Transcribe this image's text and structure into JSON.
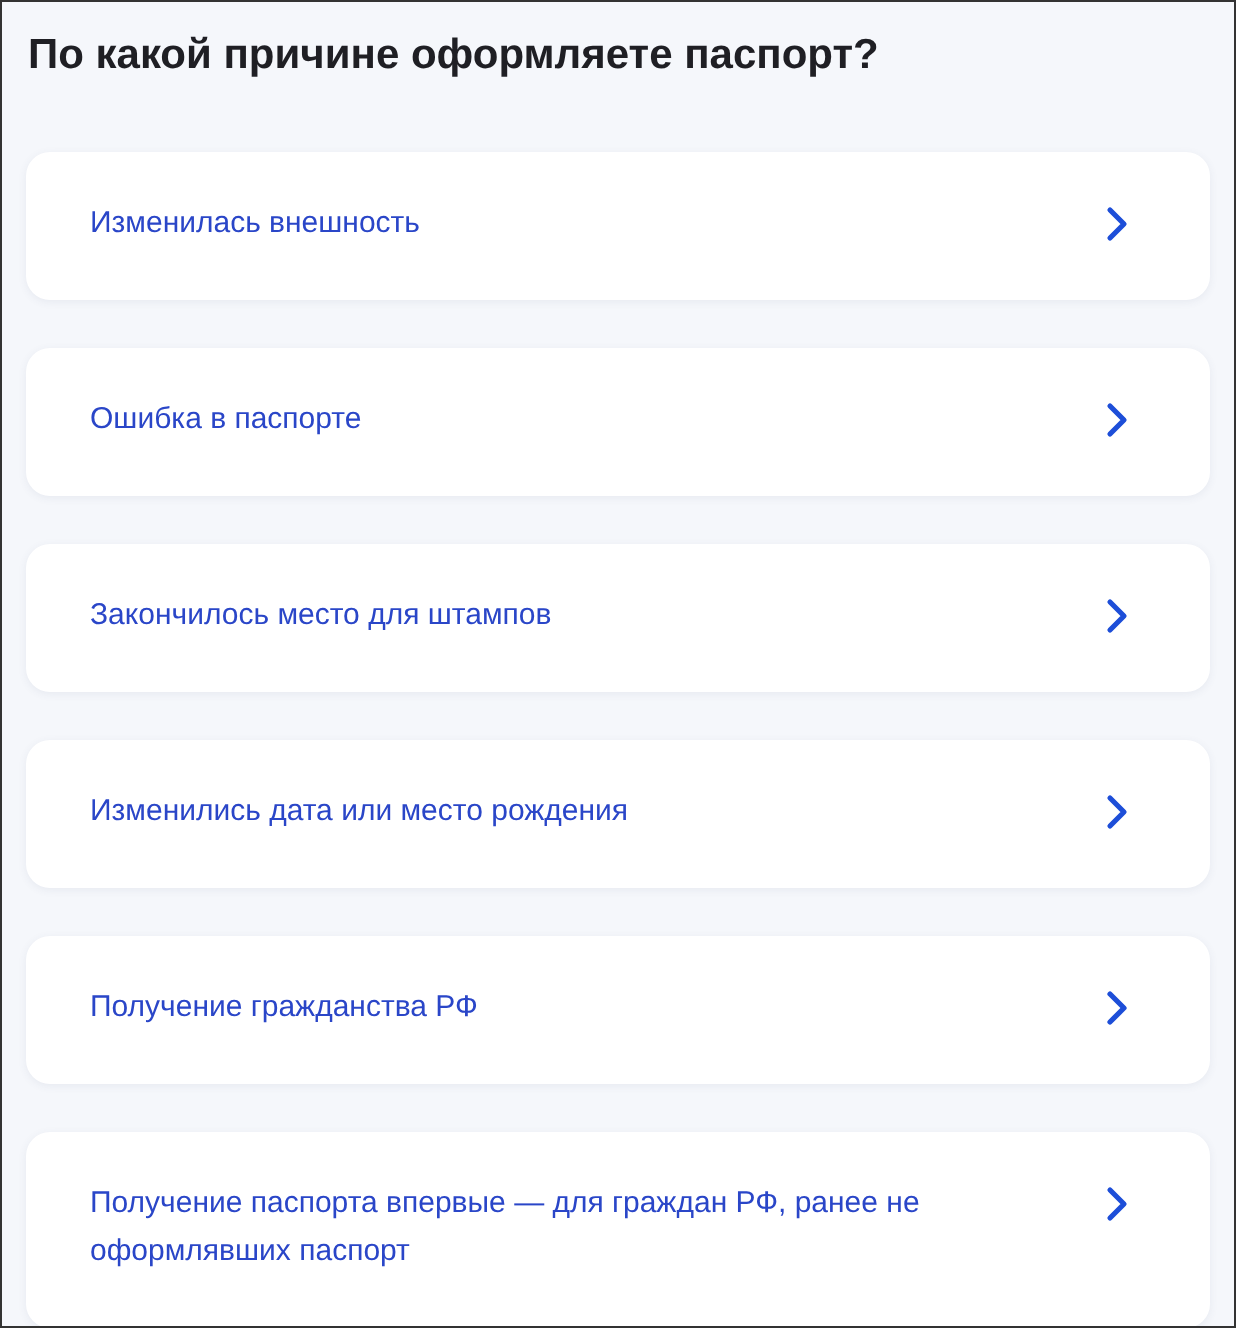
{
  "title": "По какой причине оформляете паспорт?",
  "options": [
    {
      "label": "Изменилась внешность"
    },
    {
      "label": "Ошибка в паспорте"
    },
    {
      "label": "Закончилось место для штампов"
    },
    {
      "label": "Изменились дата или место рождения"
    },
    {
      "label": "Получение гражданства РФ"
    },
    {
      "label": "Получение паспорта впервые — для граждан РФ, ранее не оформлявших паспорт"
    }
  ]
}
